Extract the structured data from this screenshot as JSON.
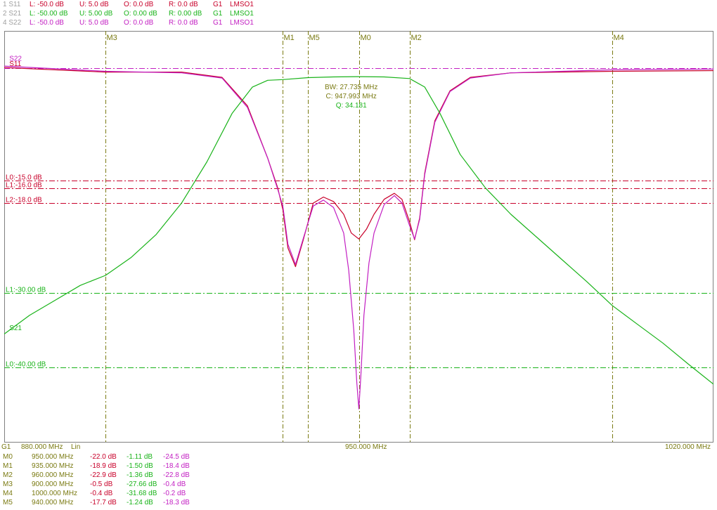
{
  "header_rows": [
    {
      "label": "1 S11",
      "color": "#c8002a",
      "fields": [
        "L: -50.0 dB",
        "U:  5.0 dB",
        "O:  0.0 dB",
        "R:  0.0 dB",
        "G1",
        "LMSO1"
      ]
    },
    {
      "label": "2 S21",
      "color": "#19b319",
      "fields": [
        "L: -50.00 dB",
        "U: 5.00 dB",
        "O:  0.00 dB",
        "R:  0.00 dB",
        "G1",
        "LMSO1"
      ]
    },
    {
      "label": "4 S22",
      "color": "#c21ec2",
      "fields": [
        "L: -50.0 dB",
        "U:  5.0 dB",
        "O:  0.0 dB",
        "R:  0.0 dB",
        "G1",
        "LMSO1"
      ]
    }
  ],
  "colors": {
    "s11": "#c8002a",
    "s21": "#19b319",
    "s22": "#c21ec2",
    "marker": "#7a7a12",
    "grid": "#7a7a12",
    "frame": "#808080",
    "label_dim": "#a0a0a0"
  },
  "chart_data": {
    "type": "line",
    "xlim": [
      880,
      1020
    ],
    "ylim": [
      -50,
      5
    ],
    "series": [
      {
        "name": "S11",
        "color": "#c8002a",
        "points": [
          [
            880,
            0.1
          ],
          [
            900,
            -0.5
          ],
          [
            915,
            -0.5
          ],
          [
            923,
            -1.2
          ],
          [
            928,
            -5
          ],
          [
            932,
            -12
          ],
          [
            934,
            -16
          ],
          [
            935,
            -18.9
          ],
          [
            936,
            -24
          ],
          [
            937.5,
            -26.5
          ],
          [
            939,
            -23
          ],
          [
            941,
            -18
          ],
          [
            943,
            -17.2
          ],
          [
            945,
            -17.8
          ],
          [
            947,
            -19.5
          ],
          [
            948.5,
            -22
          ],
          [
            950,
            -22.8
          ],
          [
            951.5,
            -21.5
          ],
          [
            953,
            -19.5
          ],
          [
            955,
            -17.5
          ],
          [
            957,
            -16.7
          ],
          [
            958.5,
            -17.5
          ],
          [
            960,
            -20.5
          ],
          [
            961,
            -22.9
          ],
          [
            962,
            -20
          ],
          [
            963,
            -14
          ],
          [
            965,
            -7
          ],
          [
            968,
            -3
          ],
          [
            972,
            -1.2
          ],
          [
            980,
            -0.6
          ],
          [
            1000,
            -0.4
          ],
          [
            1020,
            -0.3
          ]
        ]
      },
      {
        "name": "S22",
        "color": "#c21ec2",
        "points": [
          [
            880,
            0.3
          ],
          [
            900,
            -0.4
          ],
          [
            915,
            -0.6
          ],
          [
            923,
            -1.3
          ],
          [
            928,
            -5.2
          ],
          [
            932,
            -12
          ],
          [
            934,
            -16.2
          ],
          [
            935,
            -18.4
          ],
          [
            936,
            -23.5
          ],
          [
            937.5,
            -26.2
          ],
          [
            939,
            -22.8
          ],
          [
            941,
            -18.4
          ],
          [
            943,
            -17.6
          ],
          [
            945,
            -18.6
          ],
          [
            947,
            -22
          ],
          [
            948,
            -27
          ],
          [
            949,
            -35
          ],
          [
            949.6,
            -42
          ],
          [
            950,
            -45.5
          ],
          [
            950.4,
            -41
          ],
          [
            951,
            -33
          ],
          [
            952,
            -26
          ],
          [
            953,
            -22
          ],
          [
            955,
            -18.2
          ],
          [
            957,
            -17.0
          ],
          [
            958.5,
            -18.0
          ],
          [
            960,
            -21
          ],
          [
            961,
            -22.8
          ],
          [
            962,
            -20.2
          ],
          [
            963,
            -14.2
          ],
          [
            965,
            -7.2
          ],
          [
            968,
            -3.1
          ],
          [
            972,
            -1.3
          ],
          [
            980,
            -0.6
          ],
          [
            1000,
            -0.2
          ],
          [
            1020,
            -0.1
          ]
        ]
      },
      {
        "name": "S21",
        "color": "#19b319",
        "points": [
          [
            880,
            -35.5
          ],
          [
            885,
            -33
          ],
          [
            890,
            -31
          ],
          [
            895,
            -29
          ],
          [
            900,
            -27.66
          ],
          [
            905,
            -25.3
          ],
          [
            910,
            -22.2
          ],
          [
            915,
            -18
          ],
          [
            920,
            -12.5
          ],
          [
            925,
            -6
          ],
          [
            929,
            -2.5
          ],
          [
            932,
            -1.6
          ],
          [
            935,
            -1.5
          ],
          [
            940,
            -1.24
          ],
          [
            945,
            -1.15
          ],
          [
            950,
            -1.11
          ],
          [
            955,
            -1.15
          ],
          [
            960,
            -1.36
          ],
          [
            963,
            -2.5
          ],
          [
            966,
            -6
          ],
          [
            970,
            -11.5
          ],
          [
            975,
            -16
          ],
          [
            980,
            -19.5
          ],
          [
            985,
            -22.5
          ],
          [
            990,
            -25.5
          ],
          [
            995,
            -28.5
          ],
          [
            1000,
            -31.68
          ],
          [
            1005,
            -34.2
          ],
          [
            1010,
            -36.7
          ],
          [
            1015,
            -39.5
          ],
          [
            1020,
            -42.2
          ]
        ]
      }
    ],
    "markers": [
      {
        "name": "M0",
        "x": 950
      },
      {
        "name": "M1",
        "x": 935
      },
      {
        "name": "M2",
        "x": 960
      },
      {
        "name": "M3",
        "x": 900
      },
      {
        "name": "M4",
        "x": 1000
      },
      {
        "name": "M5",
        "x": 940
      }
    ],
    "limit_lines": [
      {
        "label": "L0:-15.0 dB",
        "y": -15,
        "color": "#c8002a"
      },
      {
        "label": "L1:-16.0 dB",
        "y": -16,
        "color": "#c8002a"
      },
      {
        "label": "L2:-18.0 dB",
        "y": -18,
        "color": "#c8002a"
      },
      {
        "label": "L1:-30.00 dB",
        "y": -30,
        "color": "#19b319"
      },
      {
        "label": "L0:-40.00 dB",
        "y": -40,
        "color": "#19b319"
      }
    ],
    "reference_line": {
      "y": 0,
      "color": "#c21ec2"
    },
    "trace_labels": [
      {
        "text": "S22",
        "color": "#c21ec2",
        "x": 881,
        "y": 1.0
      },
      {
        "text": "S11",
        "color": "#c8002a",
        "x": 881,
        "y": 0.3
      },
      {
        "text": "S21",
        "color": "#19b319",
        "x": 881,
        "y": -35.0
      }
    ],
    "annotations": [
      {
        "text": "BW:  27.735 MHz",
        "color": "#7a7a12"
      },
      {
        "text": "C: 947.993 MHz",
        "color": "#7a7a12"
      },
      {
        "text": "Q:  34.181",
        "color": "#19b319"
      }
    ]
  },
  "bottom_axis": {
    "group": "G1",
    "start": "880.000 MHz",
    "scale": "Lin",
    "center": "950.000 MHz",
    "stop": "1020.000 MHz"
  },
  "marker_table": [
    {
      "name": "M0",
      "freq": "950.000 MHz",
      "s11": "-22.0 dB",
      "s21": "-1.11 dB",
      "s22": "-24.5 dB"
    },
    {
      "name": "M1",
      "freq": "935.000 MHz",
      "s11": "-18.9 dB",
      "s21": "-1.50 dB",
      "s22": "-18.4 dB"
    },
    {
      "name": "M2",
      "freq": "960.000 MHz",
      "s11": "-22.9 dB",
      "s21": "-1.36 dB",
      "s22": "-22.8 dB"
    },
    {
      "name": "M3",
      "freq": "900.000 MHz",
      "s11": "-0.5 dB",
      "s21": "-27.66 dB",
      "s22": "-0.4 dB"
    },
    {
      "name": "M4",
      "freq": "1000.000 MHz",
      "s11": "-0.4 dB",
      "s21": "-31.68 dB",
      "s22": "-0.2 dB"
    },
    {
      "name": "M5",
      "freq": "940.000 MHz",
      "s11": "-17.7 dB",
      "s21": "-1.24 dB",
      "s22": "-18.3 dB"
    }
  ]
}
